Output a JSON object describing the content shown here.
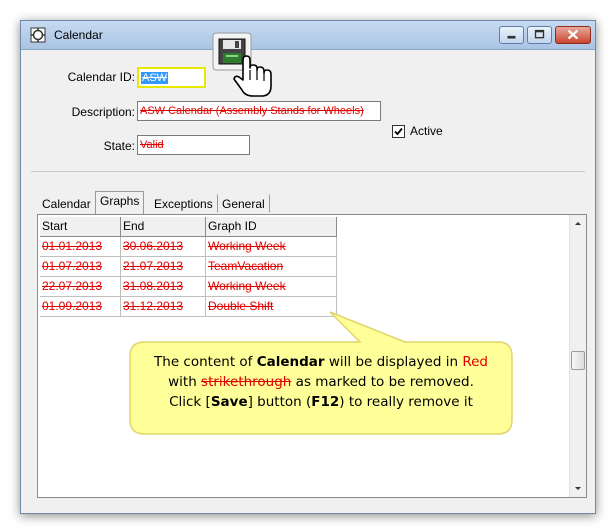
{
  "window": {
    "title": "Calendar"
  },
  "form": {
    "calendar_id_label": "Calendar ID:",
    "calendar_id_value": "ASW",
    "description_label": "Description:",
    "description_value": "ASW Calendar (Assembly Stands for Wheels)",
    "active_label": "Active",
    "active_checked": true,
    "state_label": "State:",
    "state_value": "Valid"
  },
  "tabs": [
    {
      "label": "Calendar"
    },
    {
      "label": "Graphs"
    },
    {
      "label": "Exceptions"
    },
    {
      "label": "General"
    }
  ],
  "active_tab": "Graphs",
  "grid": {
    "headers": [
      "Start",
      "End",
      "Graph ID"
    ],
    "rows": [
      [
        "01.01.2013",
        "30.06.2013",
        "Working Week"
      ],
      [
        "01.07.2013",
        "21.07.2013",
        "TeamVacation"
      ],
      [
        "22.07.2013",
        "31.08.2013",
        "Working Week"
      ],
      [
        "01.09.2013",
        "31.12.2013",
        "Double Shift"
      ]
    ]
  },
  "callout": {
    "line1_a": "The content of ",
    "line1_b": "Calendar",
    "line1_c": " will be displayed in ",
    "line1_d": "Red",
    "line2_a": "with ",
    "line2_b": "strikethrough",
    "line2_c": " as marked to be removed.",
    "line3_a": "Click [",
    "line3_b": "Save",
    "line3_c": "] button (",
    "line3_d": "F12",
    "line3_e": ") to really remove it"
  },
  "colors": {
    "removed_text": "#e00000",
    "callout_fill": "#ffff99",
    "callout_border": "#e0d56a",
    "highlight_border": "#e8e800"
  },
  "icons": [
    "calendar-app-icon",
    "minimize-icon",
    "maximize-icon",
    "close-icon",
    "save-icon",
    "hand-cursor-icon",
    "check-icon",
    "scroll-up-icon",
    "scroll-down-icon"
  ]
}
